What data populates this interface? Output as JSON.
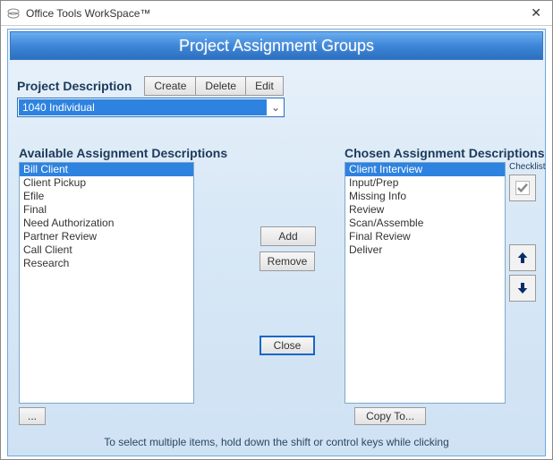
{
  "titlebar": {
    "app_title": "Office Tools WorkSpace™"
  },
  "banner": {
    "title": "Project Assignment Groups"
  },
  "project_description": {
    "label": "Project Description",
    "value": "1040 Individual",
    "buttons": {
      "create": "Create",
      "delete": "Delete",
      "edit": "Edit"
    }
  },
  "sections": {
    "available_label": "Available Assignment Descriptions",
    "chosen_label": "Chosen Assignment Descriptions",
    "checklist_label": "Checklist"
  },
  "available": {
    "items": [
      "Bill Client",
      "Client Pickup",
      "Efile",
      "Final",
      "Need Authorization",
      "Partner Review",
      "Call Client",
      "Research"
    ],
    "selected_index": 0
  },
  "chosen": {
    "items": [
      "Client Interview",
      "Input/Prep",
      "Missing Info",
      "Review",
      "Scan/Assemble",
      "Final Review",
      "Deliver"
    ],
    "selected_index": 0
  },
  "buttons": {
    "add": "Add",
    "remove": "Remove",
    "close": "Close",
    "more": "...",
    "copy_to": "Copy To..."
  },
  "hint": "To select multiple items, hold down the shift or control keys while clicking"
}
